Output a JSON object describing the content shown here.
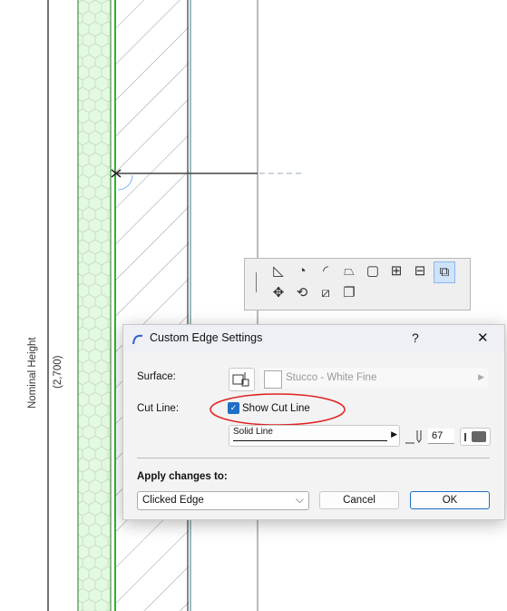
{
  "drawing": {
    "dimension_label": "Nominal Height",
    "dimension_value": "(2,700)",
    "colors": {
      "insulation": "#e3f9e0",
      "wall_edge": "#2db52d"
    }
  },
  "palette": {
    "tools": [
      "add-vertex-icon",
      "arc-vertex-icon",
      "curve-vertex-icon",
      "chamfer-corner-icon",
      "fillet-corner-icon",
      "add-to-polygon-icon",
      "subtract-from-polygon-icon",
      "custom-edge-settings-icon",
      "move-node-icon",
      "rotate-icon",
      "split-icon",
      "offset-all-edges-icon"
    ],
    "active": "custom-edge-settings-icon"
  },
  "dialog": {
    "title": "Custom Edge Settings",
    "help": "?",
    "close": "✕",
    "surface_label": "Surface:",
    "surface_value": "Stucco - White Fine",
    "cut_line_label": "Cut Line:",
    "show_cut_line": "Show Cut Line",
    "show_cut_line_checked": true,
    "line_type": "Solid Line",
    "pen_number": "67",
    "apply_label": "Apply changes to:",
    "apply_value": "Clicked Edge",
    "cancel": "Cancel",
    "ok": "OK",
    "accent": "#1f6fc5",
    "annotation_color": "#e02020"
  }
}
